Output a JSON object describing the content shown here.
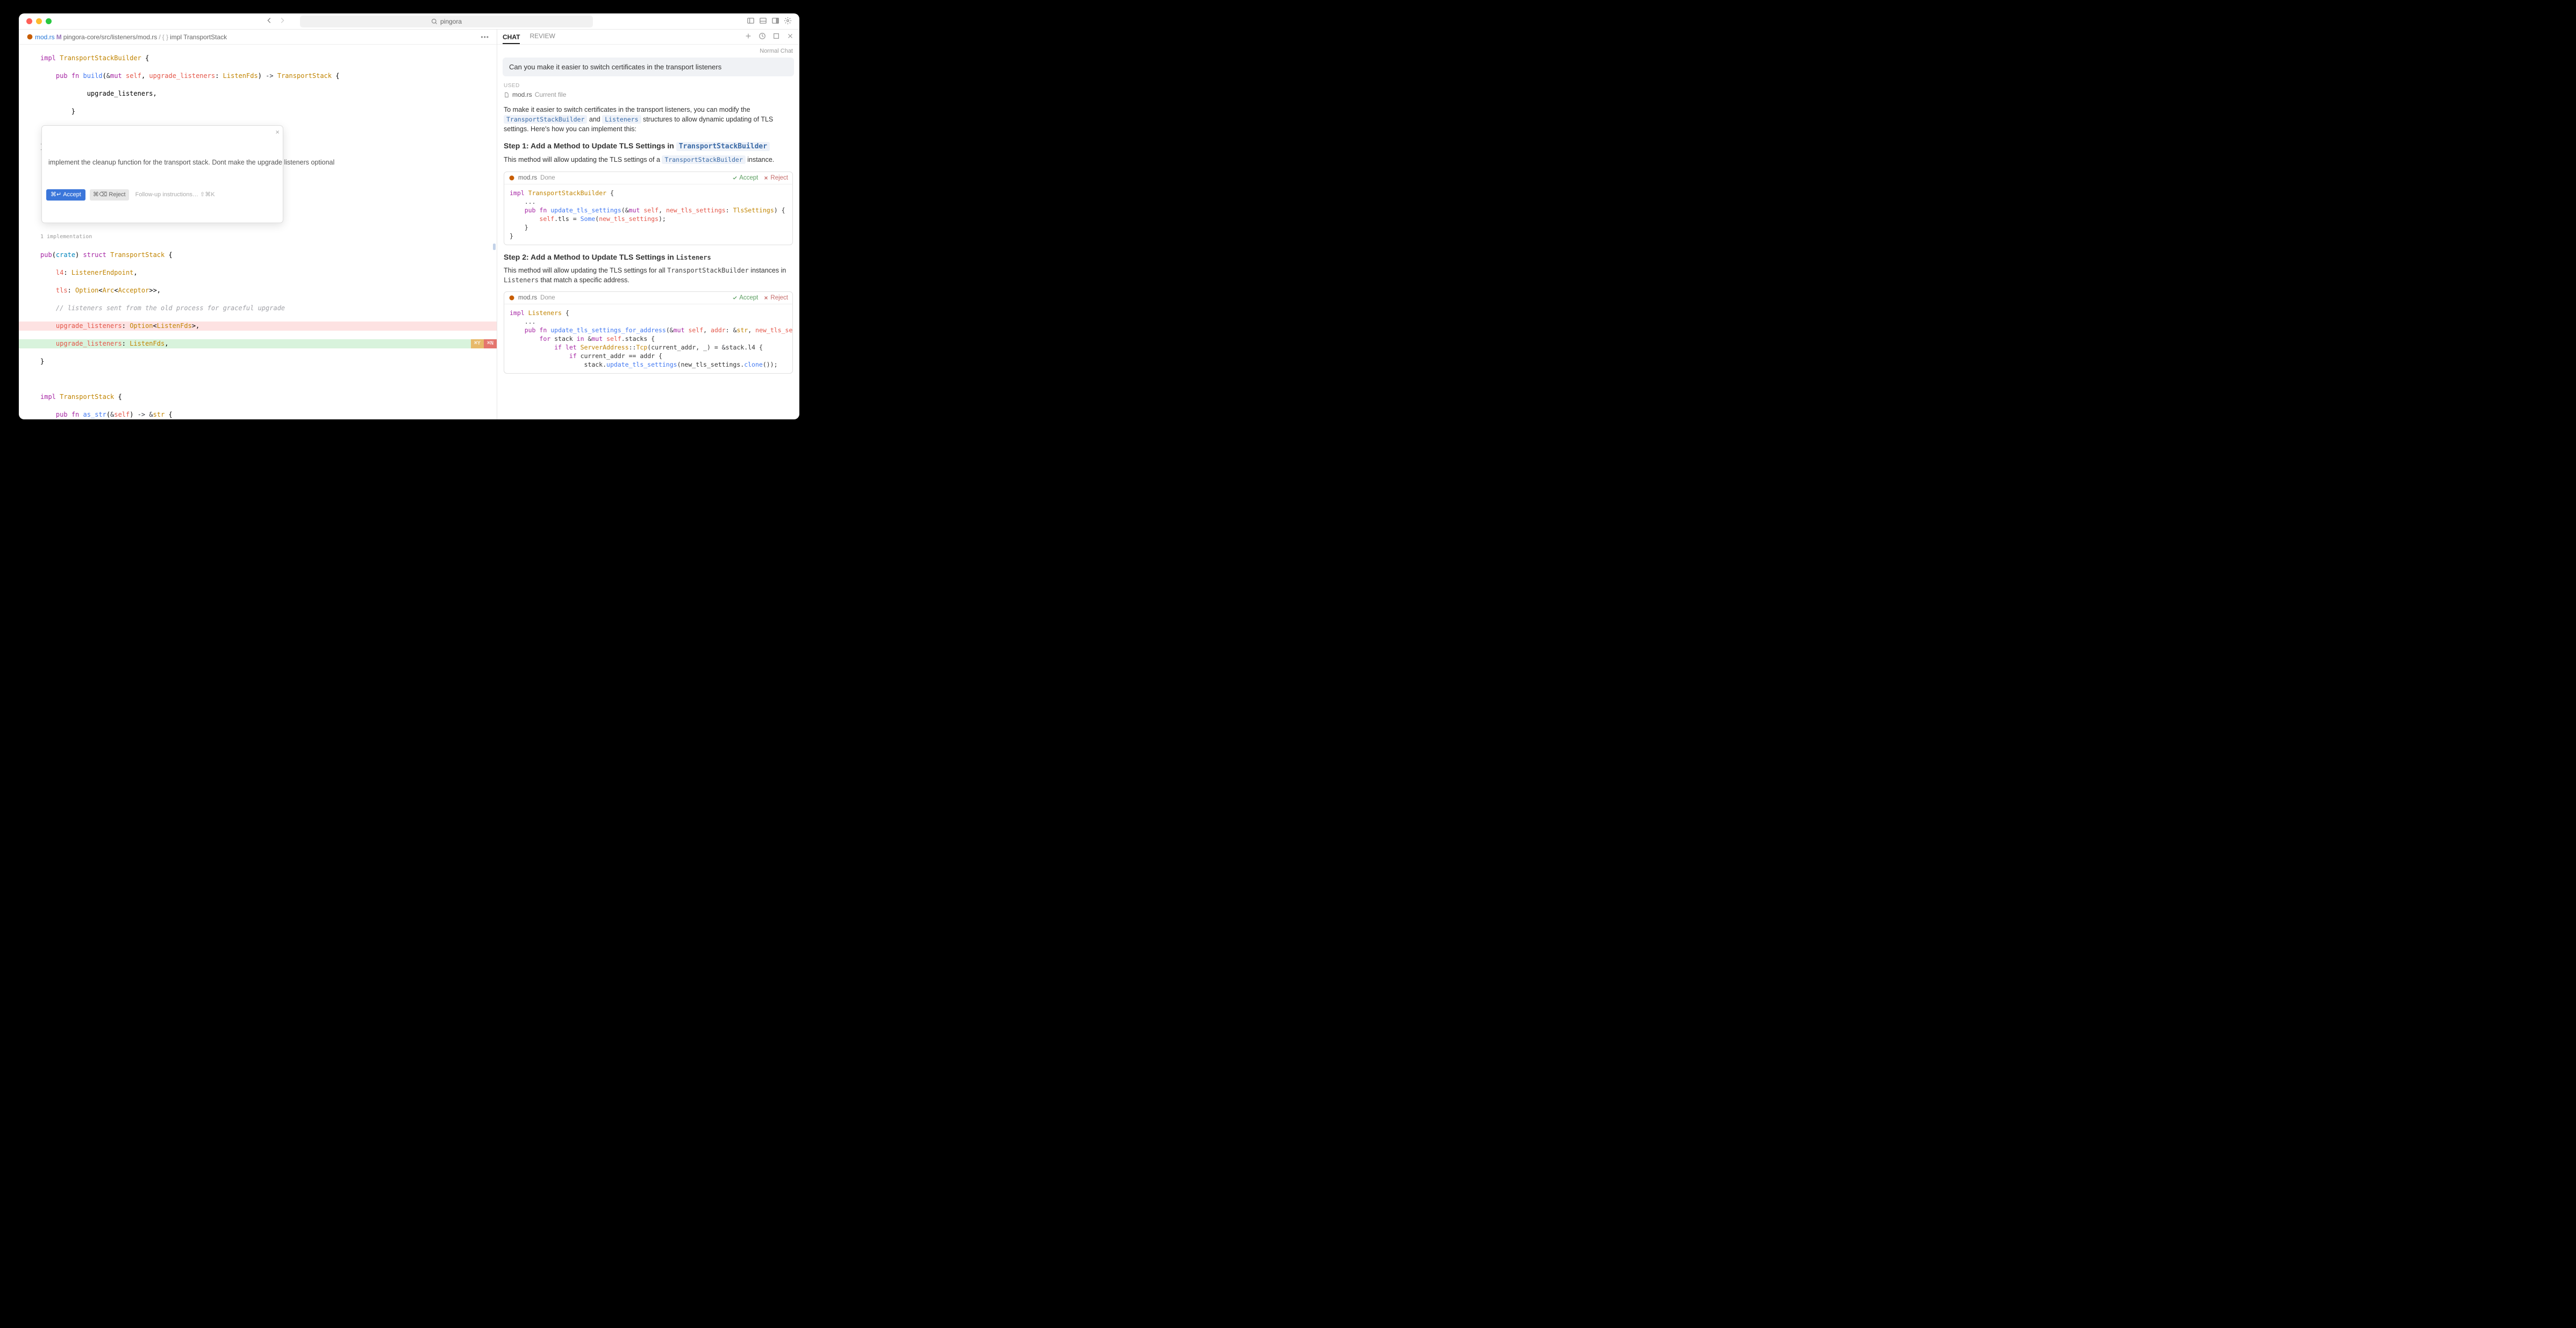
{
  "titlebar": {
    "search": "pingora"
  },
  "breadcrumb": {
    "filename": "mod.rs",
    "modified": "M",
    "path": "pingora-core/src/listeners/mod.rs",
    "symbol": "impl TransportStack"
  },
  "inline_suggestion": {
    "text": "implement the cleanup function for the transport stack. Dont make the upgrade listeners optional",
    "accept_kb": "⌘↵",
    "accept_label": "Accept",
    "reject_kb": "⌘⌫",
    "reject_label": "Reject",
    "followup": "Follow-up instructions…",
    "followup_kb": "⇧⌘K"
  },
  "badges": {
    "y": "⌘Y",
    "n": "⌘N"
  },
  "impl_note": "1 implementation",
  "chat": {
    "tabs": {
      "chat": "CHAT",
      "review": "REVIEW"
    },
    "mode": "Normal Chat",
    "input": "Can you make it easier to switch certificates in the transport listeners",
    "used": "USED",
    "file": "mod.rs",
    "file_note": "Current file",
    "para1_a": "To make it easier to switch certificates in the transport listeners, you can modify the ",
    "para1_b": " and ",
    "para1_c": " structures to allow dynamic updating of TLS settings. Here's how you can implement this:",
    "tok_builder": "TransportStackBuilder",
    "tok_listeners": "Listeners",
    "step1_pre": "Step 1: Add a Method to Update TLS Settings in ",
    "step1_desc_a": "This method will allow updating the TLS settings of a ",
    "step1_desc_b": " instance.",
    "step2_pre": "Step 2: Add a Method to Update TLS Settings in ",
    "step2_desc_a": "This method will allow updating the TLS settings for all ",
    "step2_desc_b": " instances in ",
    "step2_desc_c": " that match a specific address.",
    "cb_file": "mod.rs",
    "cb_done": "Done",
    "cb_accept": "Accept",
    "cb_reject": "Reject"
  }
}
